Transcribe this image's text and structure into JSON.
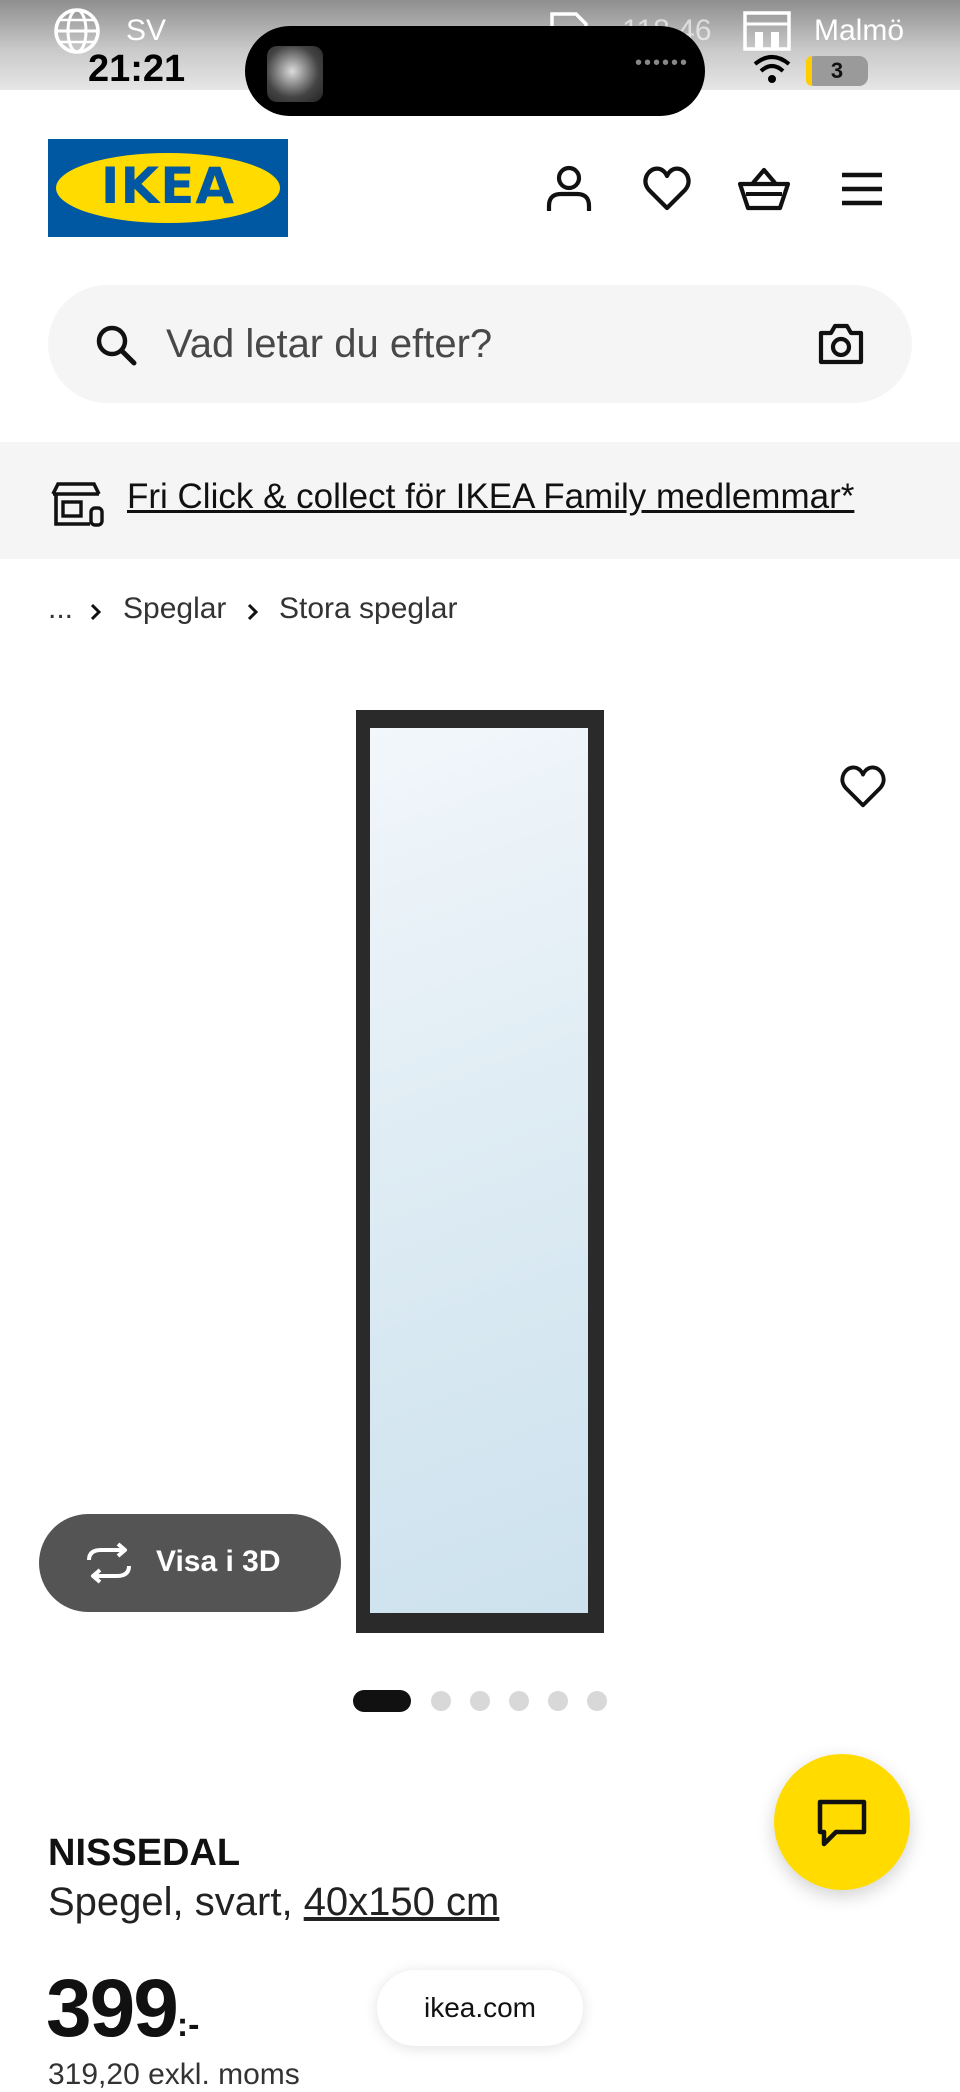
{
  "status_bar": {
    "language": "SV",
    "time": "21:21",
    "data_usage": "118.46",
    "location": "Malmö",
    "battery": "3"
  },
  "header": {
    "logo_text": "IKEA",
    "icons": [
      "user-icon",
      "heart-icon",
      "basket-icon",
      "menu-icon"
    ]
  },
  "search": {
    "placeholder": "Vad letar du efter?"
  },
  "banner": {
    "text": "Fri Click & collect för IKEA Family medlemmar*"
  },
  "breadcrumb": {
    "ellipsis": "...",
    "items": [
      "Speglar",
      "Stora speglar"
    ]
  },
  "gallery": {
    "view_3d_label": "Visa i 3D",
    "image_count": 6,
    "active_index": 0
  },
  "product": {
    "name": "NISSEDAL",
    "description": "Spegel, svart, ",
    "size": "40x150 cm",
    "price": "399",
    "price_suffix": ":-",
    "price_excl_vat": "319,20 exkl. moms"
  },
  "browser": {
    "url": "ikea.com"
  },
  "colors": {
    "ikea_blue": "#0058a3",
    "ikea_yellow": "#ffdb00"
  }
}
